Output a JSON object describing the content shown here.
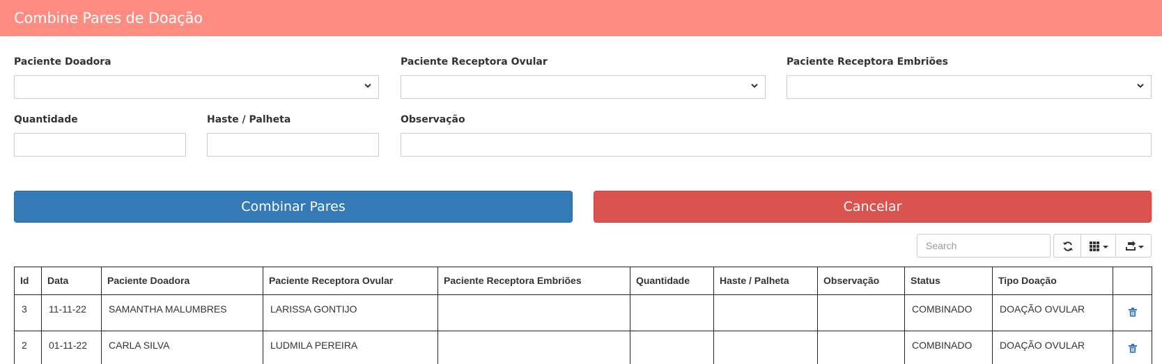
{
  "header": {
    "title": "Combine Pares de Doação"
  },
  "form": {
    "paciente_doadora_label": "Paciente Doadora",
    "paciente_receptora_ovular_label": "Paciente Receptora Ovular",
    "paciente_receptora_embrioes_label": "Paciente Receptora Embriões",
    "quantidade_label": "Quantidade",
    "haste_palheta_label": "Haste / Palheta",
    "observacao_label": "Observação"
  },
  "buttons": {
    "combinar": "Combinar Pares",
    "cancelar": "Cancelar"
  },
  "toolbar": {
    "search_placeholder": "Search",
    "refresh_icon": "refresh-icon",
    "columns_icon": "grid-icon",
    "export_icon": "export-icon"
  },
  "table": {
    "headers": [
      "Id",
      "Data",
      "Paciente Doadora",
      "Paciente Receptora Ovular",
      "Paciente Receptora Embriões",
      "Quantidade",
      "Haste / Palheta",
      "Observação",
      "Status",
      "Tipo Doação",
      ""
    ],
    "rows": [
      [
        "3",
        "11-11-22",
        "SAMANTHA MALUMBRES",
        "LARISSA GONTIJO",
        "",
        "",
        "",
        "",
        "COMBINADO",
        "DOAÇÃO OVULAR"
      ],
      [
        "2",
        "01-11-22",
        "CARLA SILVA",
        "LUDMILA PEREIRA",
        "",
        "",
        "",
        "",
        "COMBINADO",
        "DOAÇÃO OVULAR"
      ]
    ]
  },
  "colors": {
    "header_bg": "#ff8c80",
    "primary": "#337ab7",
    "danger": "#d9534f",
    "icon_blue": "#337ab7"
  }
}
